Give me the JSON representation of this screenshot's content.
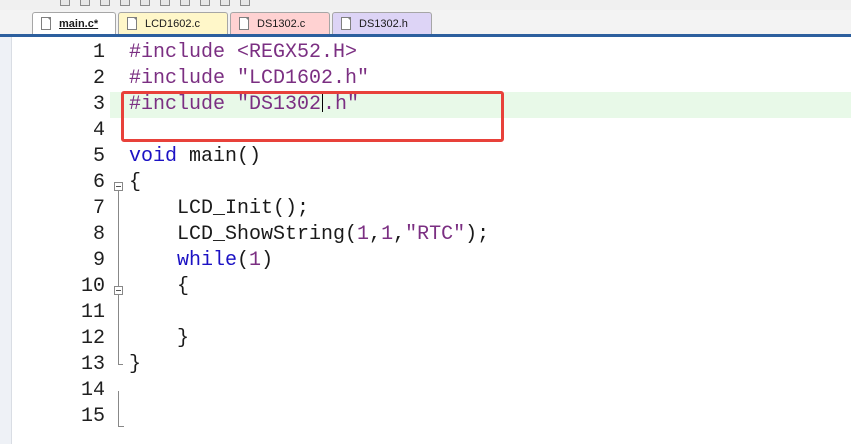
{
  "tabs": [
    {
      "label": "main.c*",
      "active": true,
      "color": "#ffffff"
    },
    {
      "label": "LCD1602.c",
      "active": false,
      "color": "#fff7c9"
    },
    {
      "label": "DS1302.c",
      "active": false,
      "color": "#ffd2d2"
    },
    {
      "label": "DS1302.h",
      "active": false,
      "color": "#ddd4f6"
    }
  ],
  "editor": {
    "line_numbers": [
      "1",
      "2",
      "3",
      "4",
      "5",
      "6",
      "7",
      "8",
      "9",
      "10",
      "11",
      "12",
      "13",
      "14",
      "15"
    ],
    "highlighted_line": 3,
    "lines": {
      "l1_pp": "#include",
      "l1_arg": " <REGX52.H>",
      "l2_pp": "#include",
      "l2_arg": " \"LCD1602.h\"",
      "l3_pp": "#include",
      "l3_arg_a": " \"DS1302",
      "l3_arg_b": ".h\"",
      "l5_kw": "void",
      "l5_rest": " main()",
      "l6": "{",
      "l7": "    LCD_Init();",
      "l8_a": "    LCD_ShowString(",
      "l8_n1": "1",
      "l8_comma1": ",",
      "l8_n2": "1",
      "l8_comma2": ",",
      "l8_str": "\"RTC\"",
      "l8_end": ");",
      "l9_indent": "    ",
      "l9_kw": "while",
      "l9_open": "(",
      "l9_n": "1",
      "l9_close": ")",
      "l10": "    {",
      "l12": "    }",
      "l13": "}"
    }
  },
  "colors": {
    "keyword": "#1c12c4",
    "preprocessor": "#7b2f82",
    "highlight_row": "#e8f9e8",
    "annotation_box": "#e8413a",
    "tab_underline": "#2c5f9e"
  }
}
